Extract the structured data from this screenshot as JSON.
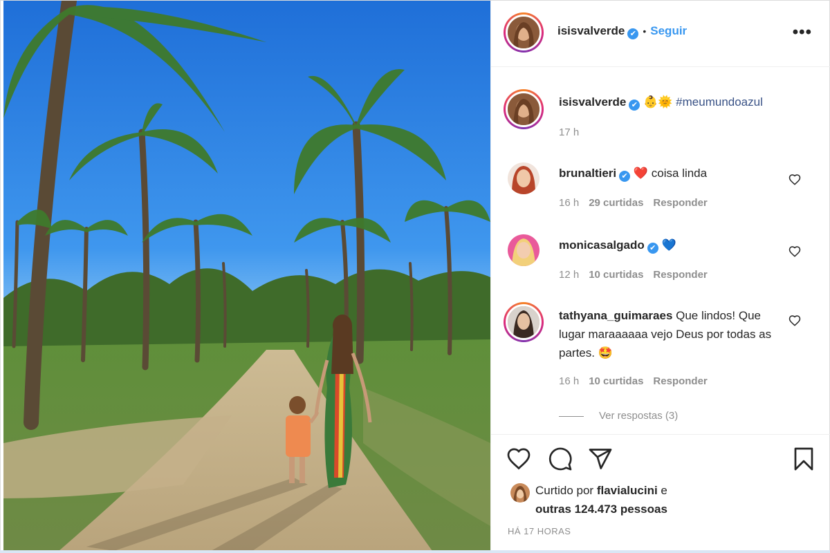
{
  "post": {
    "author": "isisvalverde",
    "verified_mark": "✔",
    "separator": "•",
    "follow_label": "Seguir",
    "more_label": "•••",
    "caption": {
      "username": "isisvalverde",
      "emojis": "👶🌞",
      "hashtag": "#meumundoazul",
      "time": "17 h"
    }
  },
  "comments": [
    {
      "username": "brunaltieri",
      "verified": true,
      "text": " coisa linda",
      "emoji": "❤️",
      "emoji_color": "#e0245e",
      "time": "16 h",
      "likes": "29 curtidas",
      "reply": "Responder"
    },
    {
      "username": "monicasalgado",
      "verified": true,
      "text": "",
      "emoji": "💙",
      "emoji_color": "#1e6fd9",
      "time": "12 h",
      "likes": "10 curtidas",
      "reply": "Responder"
    },
    {
      "username": "tathyana_guimaraes",
      "verified": false,
      "text": " Que lindos! Que lugar maraaaaaa vejo Deus por todas as partes. 🤩",
      "time": "16 h",
      "likes": "10 curtidas",
      "reply": "Responder"
    }
  ],
  "view_replies": "Ver respostas (3)",
  "likes": {
    "prefix": "Curtido por ",
    "user": "flavialucini",
    "joiner": " e",
    "others": "outras 124.473 pessoas"
  },
  "timestamp": "HÁ 17 HORAS",
  "icons": {
    "like": "heart-icon",
    "comment": "comment-icon",
    "share": "paper-plane-icon",
    "save": "bookmark-icon"
  },
  "colors": {
    "link_blue": "#3897f0",
    "hashtag_blue": "#385185",
    "muted": "#8e8e8e",
    "text": "#262626"
  }
}
